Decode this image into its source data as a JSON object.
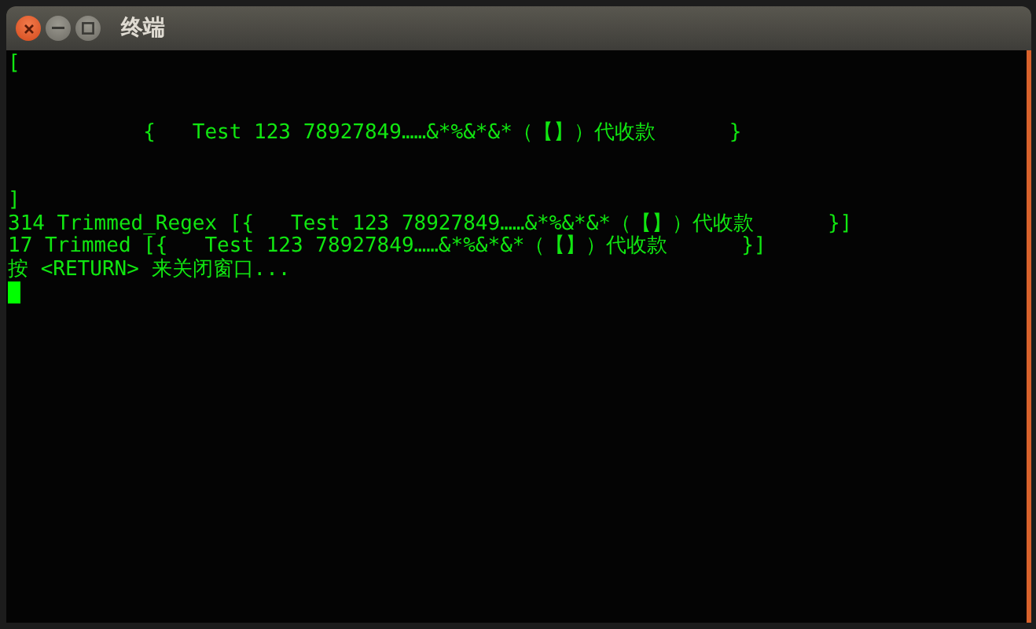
{
  "window": {
    "title": "终端"
  },
  "terminal": {
    "lines": [
      {
        "kind": "output",
        "text": "["
      },
      {
        "kind": "blank"
      },
      {
        "kind": "blank"
      },
      {
        "kind": "output",
        "text": "           {   Test 123 78927849……&*%&*&*（【】）代收款      }"
      },
      {
        "kind": "blank"
      },
      {
        "kind": "blank"
      },
      {
        "kind": "output",
        "text": "]"
      },
      {
        "kind": "output",
        "text": "314 Trimmed_Regex [{   Test 123 78927849……&*%&*&*（【】）代收款      }]"
      },
      {
        "kind": "output",
        "text": "17 Trimmed [{   Test 123 78927849……&*%&*&*（【】）代收款      }]"
      },
      {
        "kind": "output",
        "text": "按 <RETURN> 来关闭窗口..."
      },
      {
        "kind": "cursor"
      }
    ]
  }
}
